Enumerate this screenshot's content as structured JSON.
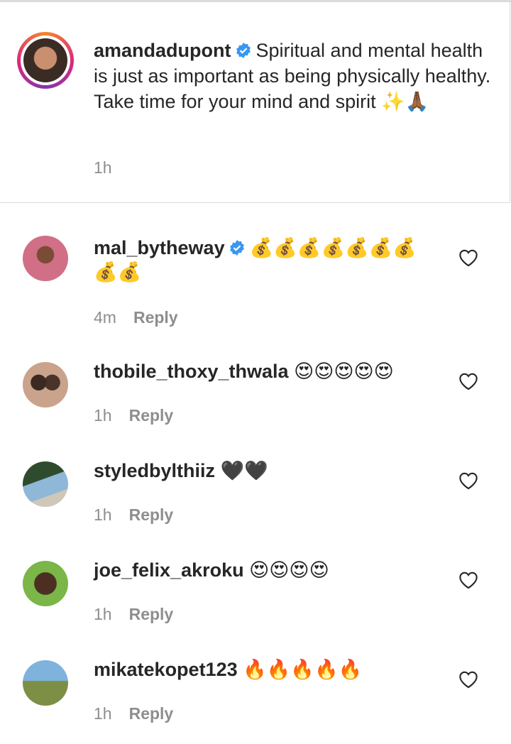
{
  "caption": {
    "username": "amandadupont",
    "text": "Spiritual and mental health is just as important as being physically healthy. Take time for your mind and spirit",
    "emoji_trail": "✨🙏🏾",
    "time": "1h"
  },
  "reply_label": "Reply",
  "comments": [
    {
      "username": "mal_bytheway",
      "verified": true,
      "emojis": "💰💰💰💰💰💰💰💰💰",
      "time": "4m"
    },
    {
      "username": "thobile_thoxy_thwala",
      "verified": false,
      "emojis": "😍😍😍😍😍",
      "time": "1h"
    },
    {
      "username": "styledbylthiiz",
      "verified": false,
      "emojis": "🖤🖤",
      "time": "1h"
    },
    {
      "username": "joe_felix_akroku",
      "verified": false,
      "emojis": "😍😍😍😍",
      "time": "1h"
    },
    {
      "username": "mikatekopet123",
      "verified": false,
      "emojis": "🔥🔥🔥🔥🔥",
      "time": "1h"
    }
  ],
  "colors": {
    "verified": "#3897f0",
    "muted": "#8e8e8e",
    "text": "#262626"
  }
}
